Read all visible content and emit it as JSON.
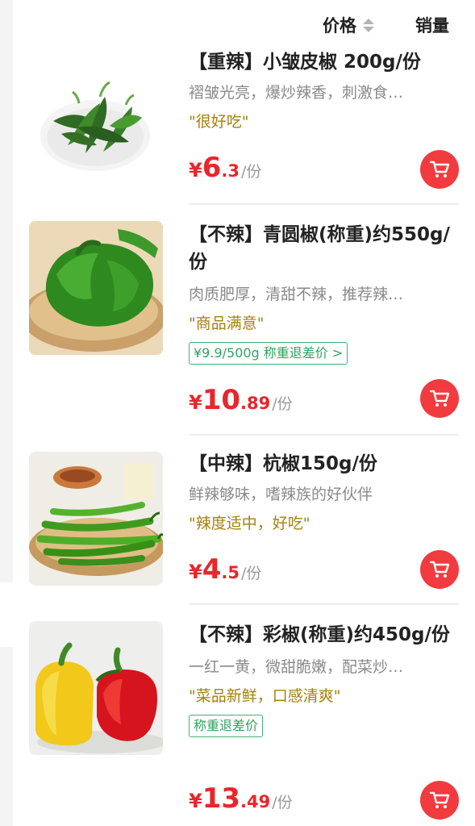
{
  "sort_bar": {
    "price_label": "价格",
    "sales_label": "销量"
  },
  "products": [
    {
      "name": "【重辣】小皱皮椒 200g/份",
      "desc": "褶皱光亮，爆炒辣香，刺激食…",
      "review": "\"很好吃\"",
      "tag": "",
      "price_int": "6",
      "price_dec": ".3",
      "unit": "/份",
      "currency": "¥",
      "image_icon": "wrinkled-green-pepper-photo"
    },
    {
      "name": "【不辣】青圆椒(称重)约550g/份",
      "desc": "肉质肥厚，清甜不辣，推荐辣…",
      "review": "\"商品满意\"",
      "tag": "¥9.9/500g 称重退差价 >",
      "price_int": "10",
      "price_dec": ".89",
      "unit": "/份",
      "currency": "¥",
      "image_icon": "green-bell-pepper-photo"
    },
    {
      "name": "【中辣】杭椒150g/份",
      "desc": "鲜辣够味，嗜辣族的好伙伴",
      "review": "\"辣度适中，好吃\"",
      "tag": "",
      "price_int": "4",
      "price_dec": ".5",
      "unit": "/份",
      "currency": "¥",
      "image_icon": "long-green-chili-photo"
    },
    {
      "name": "【不辣】彩椒(称重)约450g/份",
      "desc": "一红一黄，微甜脆嫩，配菜炒…",
      "review": "\"菜品新鲜，口感清爽\"",
      "tag": "称重退差价",
      "price_int": "13",
      "price_dec": ".49",
      "unit": "/份",
      "currency": "¥",
      "image_icon": "red-yellow-bell-pepper-photo"
    }
  ],
  "colors": {
    "price": "#e8262b",
    "cart": "#f13b3f",
    "review": "#a6800e",
    "tag": "#2ca45e"
  }
}
